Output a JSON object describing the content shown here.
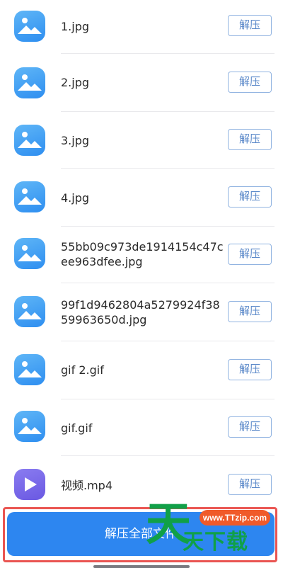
{
  "files": [
    {
      "name": "1.jpg",
      "icon": "image-icon",
      "action": "解压"
    },
    {
      "name": "2.jpg",
      "icon": "image-icon",
      "action": "解压"
    },
    {
      "name": "3.jpg",
      "icon": "image-icon",
      "action": "解压"
    },
    {
      "name": "4.jpg",
      "icon": "image-icon",
      "action": "解压"
    },
    {
      "name": "55bb09c973de1914154c47cee963dfee.jpg",
      "icon": "image-icon",
      "action": "解压"
    },
    {
      "name": "99f1d9462804a5279924f3859963650d.jpg",
      "icon": "image-icon",
      "action": "解压"
    },
    {
      "name": "gif 2.gif",
      "icon": "image-icon",
      "action": "解压"
    },
    {
      "name": "gif.gif",
      "icon": "image-icon",
      "action": "解压"
    },
    {
      "name": "视频.mp4",
      "icon": "video-icon",
      "action": "解压"
    }
  ],
  "footer": {
    "extract_all_label": "解压全部文件"
  },
  "watermark": {
    "big": "天",
    "url": "www.TTzip.com",
    "sub": "天下载"
  },
  "colors": {
    "primary_blue": "#2d86f0",
    "button_border": "#92b4e1",
    "highlight_red": "#ea5552",
    "watermark_green": "#10a048"
  }
}
